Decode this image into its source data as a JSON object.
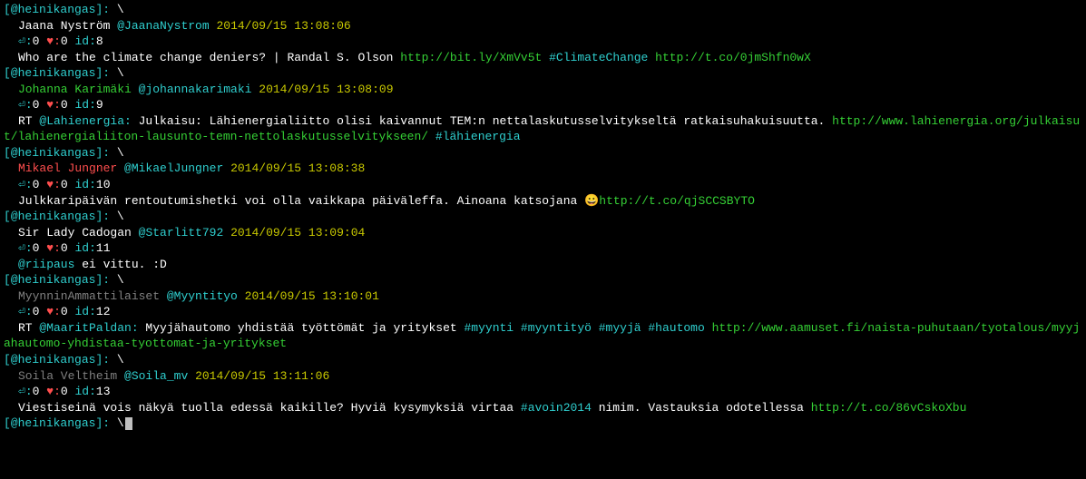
{
  "prompt_user": "@heinikangas",
  "backslash": "\\",
  "tweets": [
    {
      "name": "Jaana Nyström",
      "name_color": "white",
      "handle": "@JaanaNystrom",
      "timestamp": "2014/09/15 13:08:06",
      "rt_count": "0",
      "fav_count": "0",
      "id": "8",
      "segments": [
        {
          "t": "Who are the climate change deniers? | Randal S. Olson ",
          "c": "white"
        },
        {
          "t": "http://bit.ly/XmVv5t",
          "c": "green"
        },
        {
          "t": " ",
          "c": "white"
        },
        {
          "t": "#ClimateChange",
          "c": "cyan"
        },
        {
          "t": " ",
          "c": "white"
        },
        {
          "t": "http://t.co/0jmShfn0wX",
          "c": "green"
        }
      ]
    },
    {
      "name": "Johanna Karimäki",
      "name_color": "green",
      "handle": "@johannakarimaki",
      "timestamp": "2014/09/15 13:08:09",
      "rt_count": "0",
      "fav_count": "0",
      "id": "9",
      "prefix": "RT ",
      "mention_lead": "@Lahienergia:",
      "segments": [
        {
          "t": " Julkaisu: Lähienergialiitto olisi kaivannut TEM:n nettalaskutusselvitykseltä ratkaisuhakuisuutta. ",
          "c": "white"
        },
        {
          "t": "http://www.lahienergia.org/julkaisut/lahienergialiiton-lausunto-temn-nettolaskutusselvitykseen/",
          "c": "green"
        },
        {
          "t": " ",
          "c": "white"
        },
        {
          "t": "#lähienergia",
          "c": "cyan"
        }
      ]
    },
    {
      "name": "Mikael Jungner",
      "name_color": "red",
      "handle": "@MikaelJungner",
      "timestamp": "2014/09/15 13:08:38",
      "rt_count": "0",
      "fav_count": "0",
      "id": "10",
      "segments": [
        {
          "t": "Julkkaripäivän rentoutumishetki voi olla vaikkapa päiväleffa. Ainoana katsojana 😀",
          "c": "white"
        },
        {
          "t": "http://t.co/qjSCCSBYTO",
          "c": "green"
        }
      ]
    },
    {
      "name": "Sir Lady Cadogan",
      "name_color": "white",
      "handle": "@Starlitt792",
      "timestamp": "2014/09/15 13:09:04",
      "rt_count": "0",
      "fav_count": "0",
      "id": "11",
      "mention_lead": "@riipaus",
      "segments": [
        {
          "t": " ei vittu. :D",
          "c": "white"
        }
      ]
    },
    {
      "name": "MyynninAmmattilaiset",
      "name_color": "grey",
      "handle": "@Myyntityo",
      "timestamp": "2014/09/15 13:10:01",
      "rt_count": "0",
      "fav_count": "0",
      "id": "12",
      "prefix": "RT ",
      "mention_lead": "@MaaritPaldan:",
      "segments": [
        {
          "t": " Myyjähautomo yhdistää työttömät ja yritykset ",
          "c": "white"
        },
        {
          "t": "#myynti",
          "c": "cyan"
        },
        {
          "t": " ",
          "c": "white"
        },
        {
          "t": "#myyntityö",
          "c": "cyan"
        },
        {
          "t": " ",
          "c": "white"
        },
        {
          "t": "#myyjä",
          "c": "cyan"
        },
        {
          "t": " ",
          "c": "white"
        },
        {
          "t": "#hautomo",
          "c": "cyan"
        },
        {
          "t": " ",
          "c": "white"
        },
        {
          "t": "http://www.aamuset.fi/naista-puhutaan/tyotalous/myyjahautomo-yhdistaa-tyottomat-ja-yritykset",
          "c": "green"
        }
      ]
    },
    {
      "name": "Soila Veltheim",
      "name_color": "grey",
      "handle": "@Soila_mv",
      "timestamp": "2014/09/15 13:11:06",
      "rt_count": "0",
      "fav_count": "0",
      "id": "13",
      "segments": [
        {
          "t": "Viestiseinä vois näkyä tuolla edessä kaikille? Hyviä kysymyksiä virtaa ",
          "c": "white"
        },
        {
          "t": "#avoin2014",
          "c": "cyan"
        },
        {
          "t": " nimim. Vastauksia odotellessa ",
          "c": "white"
        },
        {
          "t": "http://t.co/86vCskoXbu",
          "c": "green"
        }
      ]
    }
  ],
  "labels": {
    "rt_sym": "⏎:",
    "fav_sym": "♥:",
    "id_label": "id:"
  }
}
